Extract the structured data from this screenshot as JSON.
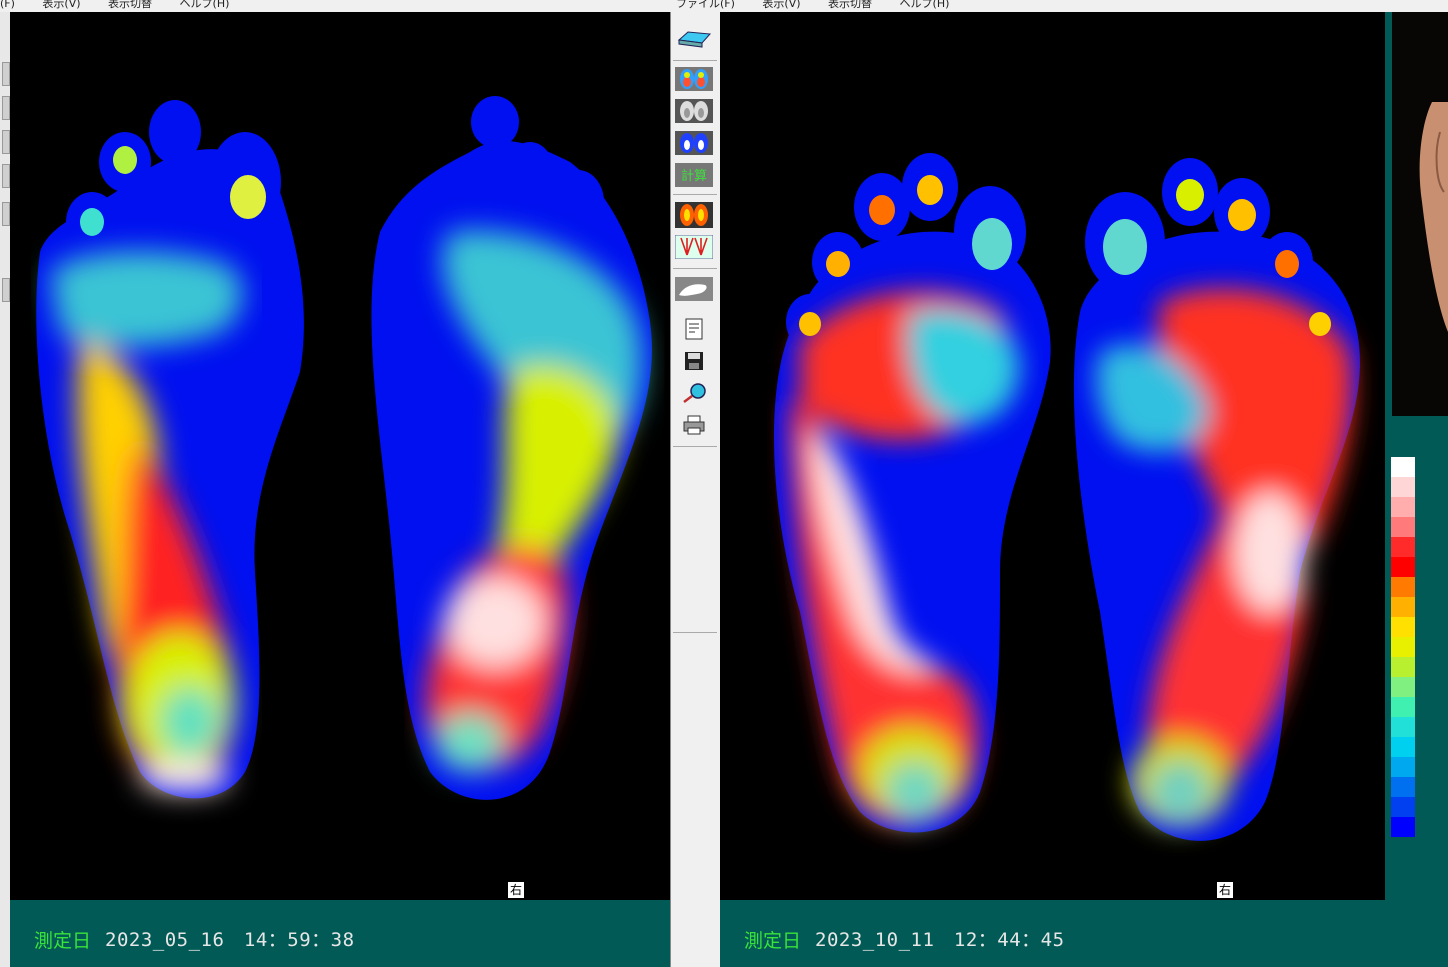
{
  "menubar": {
    "left_items": [
      "(F)",
      "表示(V)",
      "表示切替",
      "ヘルプ(H)"
    ],
    "right_items": [
      "ファイル(F)",
      "表示(V)",
      "表示切替",
      "ヘルプ(H)"
    ]
  },
  "left_panel": {
    "side_label": "右",
    "measure_label": "測定日",
    "measure_datetime": "2023_05_16　14：59：38"
  },
  "right_panel": {
    "side_label": "右",
    "measure_label": "測定日",
    "measure_datetime": "2023_10_11　12：44：45"
  },
  "toolbar": {
    "icons": [
      "scanner-icon",
      "color-feet-icon",
      "gray-feet-icon",
      "blue-feet-icon",
      "calc-icon",
      "heat-feet-icon",
      "lines-feet-icon",
      "foot-scan-icon",
      "document-icon",
      "save-icon",
      "search-icon",
      "print-icon"
    ],
    "calc_label": "計算"
  },
  "colors": {
    "status_bg": "#015a55",
    "label_green": "#39e23a",
    "canvas_bg": "#000000",
    "scale": [
      "#ffffff",
      "#ffd6d6",
      "#ffadad",
      "#ff7b7b",
      "#ff2a2a",
      "#ff0000",
      "#ff7a00",
      "#ffb000",
      "#ffe000",
      "#e8f000",
      "#b8f030",
      "#80f080",
      "#40f0b0",
      "#20e0d8",
      "#00d0f0",
      "#00a8f0",
      "#0070f0",
      "#0040f0",
      "#0000ff"
    ]
  }
}
